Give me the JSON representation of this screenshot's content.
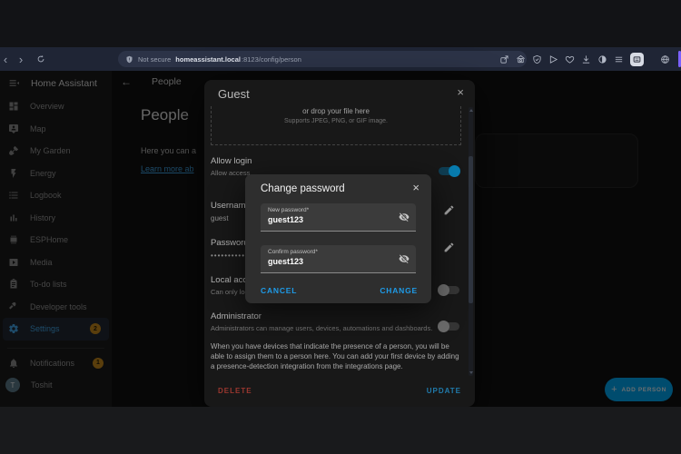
{
  "browser": {
    "security_label": "Not secure",
    "url_host": "homeassistant.local",
    "url_path": ":8123/config/person",
    "icons": [
      "back-icon",
      "forward-icon",
      "reload-icon",
      "not-secure-shield-icon",
      "share-icon",
      "screenshot-icon",
      "shield-check-icon",
      "send-icon",
      "favorites-heart-icon",
      "download-icon",
      "reading-mode-icon",
      "menu-icon",
      "profile-avatar",
      "globe-icon"
    ]
  },
  "sidebar": {
    "title": "Home Assistant",
    "items": [
      {
        "label": "Overview",
        "icon": "dashboard-icon"
      },
      {
        "label": "Map",
        "icon": "map-person-icon"
      },
      {
        "label": "My Garden",
        "icon": "shovel-icon"
      },
      {
        "label": "Energy",
        "icon": "lightning-icon"
      },
      {
        "label": "Logbook",
        "icon": "list-icon"
      },
      {
        "label": "History",
        "icon": "bar-chart-icon"
      },
      {
        "label": "ESPHome",
        "icon": "chip-icon"
      },
      {
        "label": "Media",
        "icon": "play-box-icon"
      },
      {
        "label": "To-do lists",
        "icon": "clipboard-icon"
      },
      {
        "label": "Developer tools",
        "icon": "hammer-icon"
      },
      {
        "label": "Settings",
        "icon": "gear-icon",
        "selected": true,
        "badge": "2"
      }
    ],
    "notifications": {
      "label": "Notifications",
      "badge": "1",
      "icon": "bell-icon"
    },
    "user": {
      "initial": "T",
      "name": "Toshit"
    }
  },
  "page": {
    "header_title": "People",
    "back_icon": "←",
    "heading": "People",
    "intro_text": "Here you can a",
    "learn_more_text": "Learn more ab",
    "fab": {
      "plus": "+",
      "label": "ADD PERSON"
    }
  },
  "guest_dialog": {
    "title": "Guest",
    "close_icon": "×",
    "upload": {
      "drop_text": "or drop your file here",
      "supports_text": "Supports JPEG, PNG, or GIF image."
    },
    "allow_login": {
      "label": "Allow login",
      "description": "Allow access",
      "toggle_on": true
    },
    "username": {
      "label": "Username",
      "value": "guest"
    },
    "password": {
      "label": "Password",
      "value": "••••••••••••"
    },
    "local_access": {
      "label": "Local access",
      "description": "Can only log",
      "toggle_on": false
    },
    "administrator": {
      "label": "Administrator",
      "description": "Administrators can manage users, devices, automations and dashboards.",
      "toggle_on": false
    },
    "note": "When you have devices that indicate the presence of a person, you will be able to assign them to a person here. You can add your first device by adding a presence-detection integration from the integrations page.",
    "delete_label": "DELETE",
    "update_label": "UPDATE"
  },
  "password_dialog": {
    "title": "Change password",
    "close_icon": "×",
    "new_password": {
      "label": "New password*",
      "value": "guest123"
    },
    "confirm_password": {
      "label": "Confirm password*",
      "value": "guest123"
    },
    "cancel_label": "CANCEL",
    "change_label": "CHANGE"
  },
  "colors": {
    "accent_blue": "#03a9f4",
    "toggle_on": "#0b9fe0",
    "badge_amber": "#c98a1c",
    "delete_red": "#c6473d",
    "dialog_bg": "#2e2e2e",
    "chrome_bg": "#1f2535"
  }
}
